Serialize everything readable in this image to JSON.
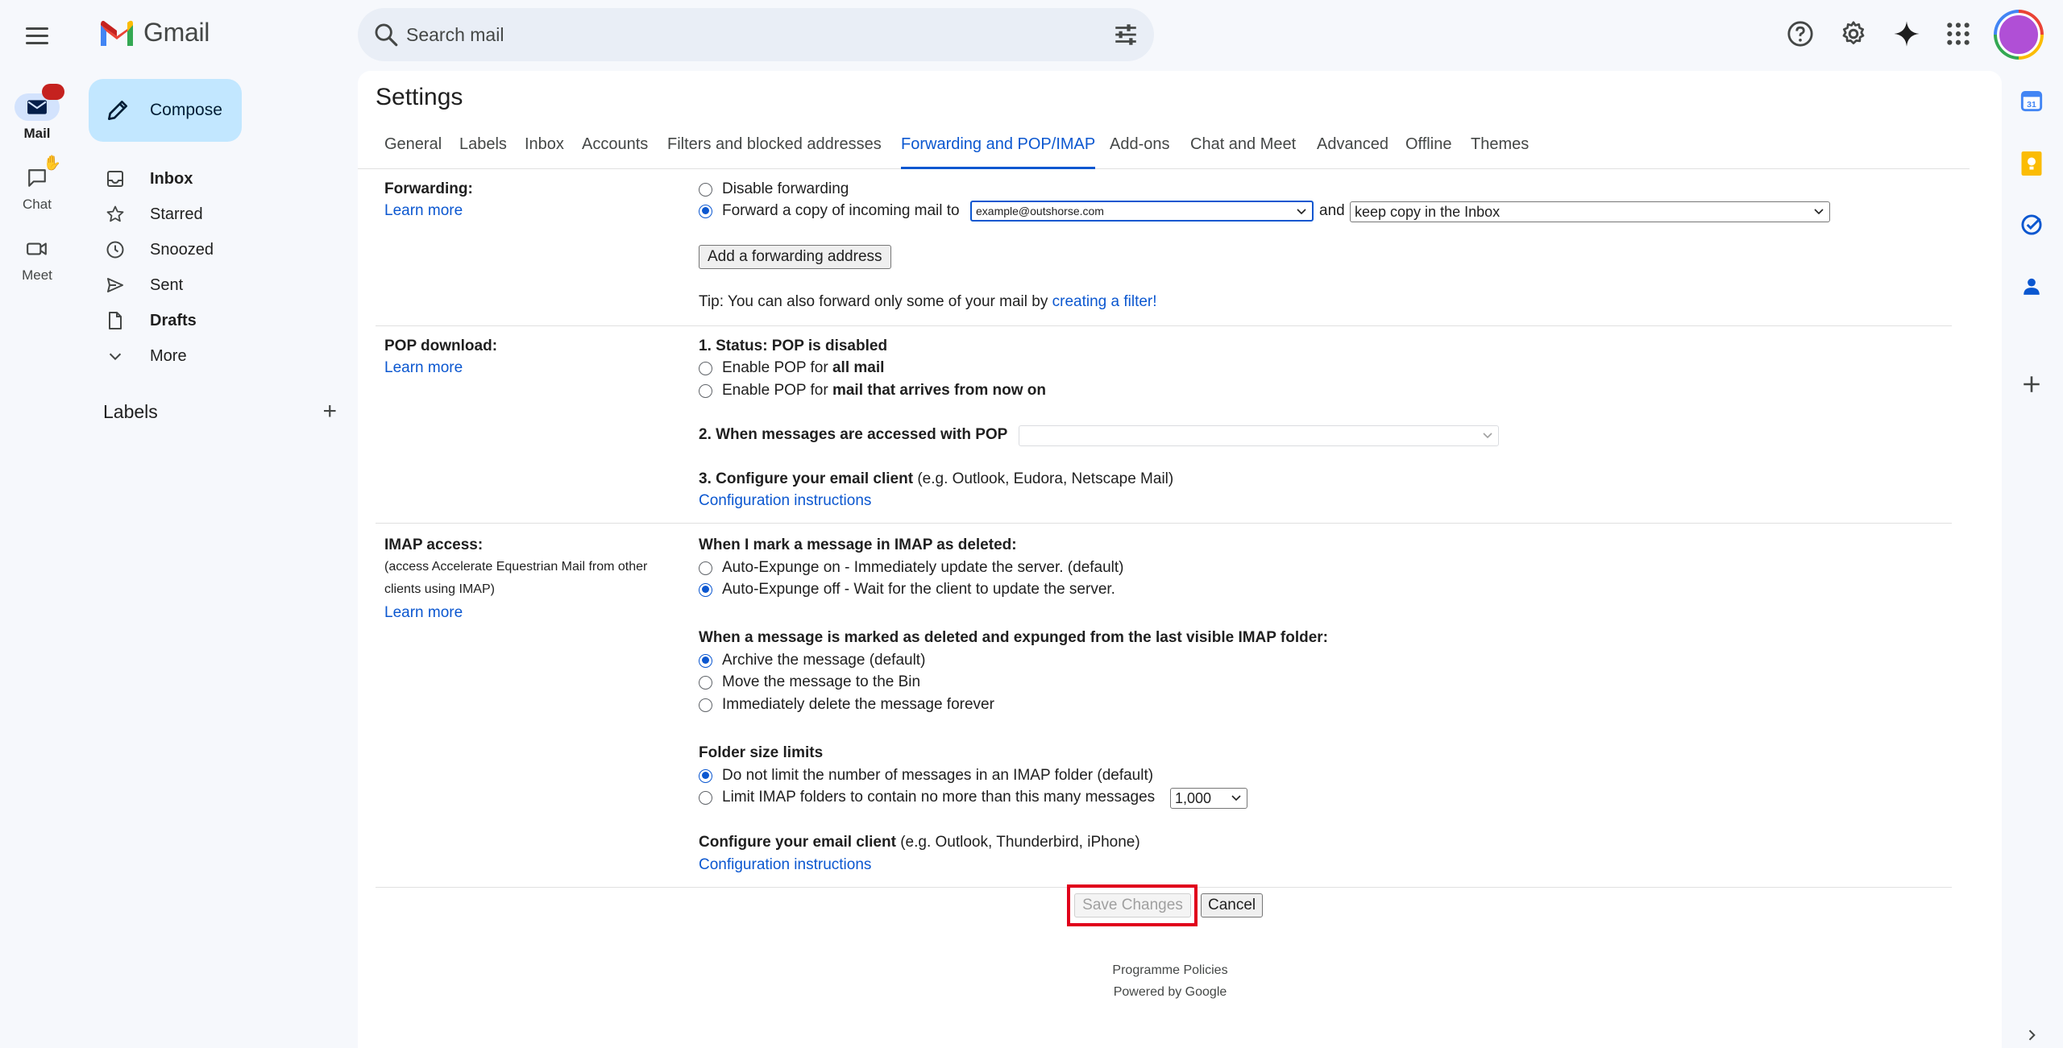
{
  "app": {
    "name": "Gmail"
  },
  "search": {
    "placeholder": "Search mail"
  },
  "rail": [
    {
      "label": "Mail"
    },
    {
      "label": "Chat"
    },
    {
      "label": "Meet"
    }
  ],
  "compose": {
    "label": "Compose"
  },
  "nav": [
    {
      "label": "Inbox"
    },
    {
      "label": "Starred"
    },
    {
      "label": "Snoozed"
    },
    {
      "label": "Sent"
    },
    {
      "label": "Drafts"
    },
    {
      "label": "More"
    }
  ],
  "labels_section": {
    "title": "Labels",
    "add": "+"
  },
  "settings": {
    "title": "Settings",
    "tabs": [
      "General",
      "Labels",
      "Inbox",
      "Accounts",
      "Filters and blocked addresses",
      "Forwarding and POP/IMAP",
      "Add-ons",
      "Chat and Meet",
      "Advanced",
      "Offline",
      "Themes"
    ],
    "active_tab": "Forwarding and POP/IMAP",
    "forwarding": {
      "label": "Forwarding:",
      "learn_more": "Learn more",
      "disable": "Disable forwarding",
      "forward_copy": "Forward a copy of incoming mail to",
      "address_value": "example@outshorse.com",
      "and": "and",
      "keep_value": "keep copy in the Inbox",
      "add_button": "Add a forwarding address",
      "tip_prefix": "Tip: You can also forward only some of your mail by",
      "tip_link": "creating a filter!"
    },
    "pop": {
      "label": "POP download:",
      "learn_more": "Learn more",
      "status": "1. Status: POP is disabled",
      "enable_all_prefix": "Enable POP for",
      "enable_all_bold": "all mail",
      "enable_now_prefix": "Enable POP for",
      "enable_now_bold": "mail that arrives from now on",
      "when_accessed": "2. When messages are accessed with POP",
      "configure_bold": "3. Configure your email client",
      "configure_rest": "(e.g. Outlook, Eudora, Netscape Mail)",
      "config_link": "Configuration instructions"
    },
    "imap": {
      "label": "IMAP access:",
      "note": "(access Accelerate Equestrian Mail from other clients using IMAP)",
      "learn_more": "Learn more",
      "deleted_heading": "When I mark a message in IMAP as deleted:",
      "auto_on": "Auto-Expunge on - Immediately update the server. (default)",
      "auto_off": "Auto-Expunge off - Wait for the client to update the server.",
      "expunged_heading": "When a message is marked as deleted and expunged from the last visible IMAP folder:",
      "archive": "Archive the message (default)",
      "move_bin": "Move the message to the Bin",
      "delete_forever": "Immediately delete the message forever",
      "folder_heading": "Folder size limits",
      "no_limit": "Do not limit the number of messages in an IMAP folder (default)",
      "limit": "Limit IMAP folders to contain no more than this many messages",
      "limit_value": "1,000",
      "configure_bold": "Configure your email client",
      "configure_rest": "(e.g. Outlook, Thunderbird, iPhone)",
      "config_link": "Configuration instructions"
    },
    "save": "Save Changes",
    "cancel": "Cancel",
    "footer": {
      "policies": "Programme Policies",
      "powered": "Powered by Google"
    }
  },
  "colors": {
    "accent": "#0b57d0",
    "compose_bg": "#c2e7ff",
    "highlight": "#e0001b"
  }
}
